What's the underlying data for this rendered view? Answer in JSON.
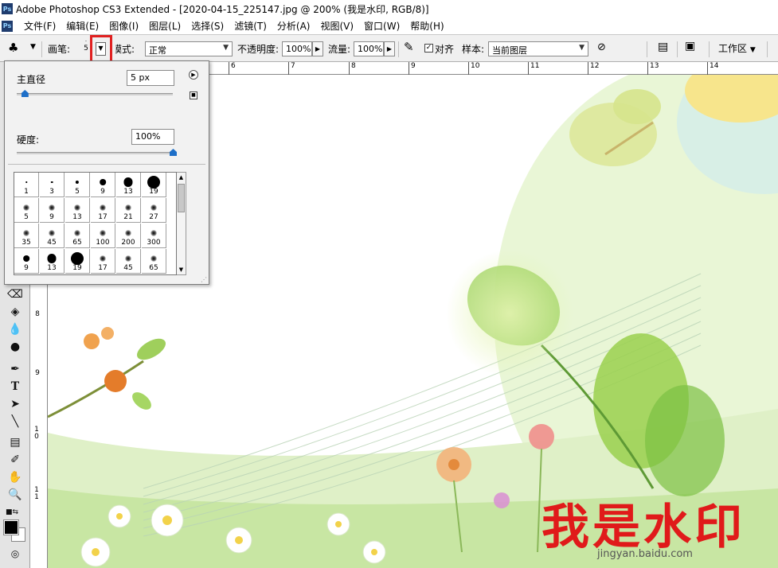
{
  "app": {
    "title": "Adobe Photoshop CS3 Extended - [2020-04-15_225147.jpg @ 200% (我是水印, RGB/8)]",
    "logo": "Ps"
  },
  "menu": [
    "文件(F)",
    "编辑(E)",
    "图像(I)",
    "图层(L)",
    "选择(S)",
    "滤镜(T)",
    "分析(A)",
    "视图(V)",
    "窗口(W)",
    "帮助(H)"
  ],
  "options": {
    "brush_label": "画笔:",
    "brush_size_preview": "5",
    "mode_label": "模式:",
    "mode_value": "正常",
    "opacity_label": "不透明度:",
    "opacity_value": "100%",
    "flow_label": "流量:",
    "flow_value": "100%",
    "aligned_label": "对齐",
    "aligned_checked": true,
    "sample_label": "样本:",
    "sample_value": "当前图层",
    "workspace_label": "工作区"
  },
  "brush_panel": {
    "diameter_label": "主直径",
    "diameter_value": "5 px",
    "diameter_fraction": 0.05,
    "hardness_label": "硬度:",
    "hardness_value": "100%",
    "hardness_fraction": 1.0,
    "presets": [
      {
        "label": "1",
        "size": 1,
        "soft": false
      },
      {
        "label": "3",
        "size": 3,
        "soft": false
      },
      {
        "label": "5",
        "size": 5,
        "soft": false
      },
      {
        "label": "9",
        "size": 9,
        "soft": false
      },
      {
        "label": "13",
        "size": 13,
        "soft": false
      },
      {
        "label": "19",
        "size": 19,
        "soft": false
      },
      {
        "label": "5",
        "size": 5,
        "soft": true
      },
      {
        "label": "9",
        "size": 9,
        "soft": true
      },
      {
        "label": "13",
        "size": 13,
        "soft": true
      },
      {
        "label": "17",
        "size": 17,
        "soft": true
      },
      {
        "label": "21",
        "size": 21,
        "soft": true
      },
      {
        "label": "27",
        "size": 27,
        "soft": true
      },
      {
        "label": "35",
        "size": 35,
        "soft": true
      },
      {
        "label": "45",
        "size": 45,
        "soft": true
      },
      {
        "label": "65",
        "size": 65,
        "soft": true
      },
      {
        "label": "100",
        "size": 100,
        "soft": true
      },
      {
        "label": "200",
        "size": 200,
        "soft": true
      },
      {
        "label": "300",
        "size": 300,
        "soft": true
      },
      {
        "label": "9",
        "size": 9,
        "soft": false
      },
      {
        "label": "13",
        "size": 13,
        "soft": false
      },
      {
        "label": "19",
        "size": 19,
        "soft": false
      },
      {
        "label": "17",
        "size": 17,
        "soft": true
      },
      {
        "label": "45",
        "size": 45,
        "soft": true
      },
      {
        "label": "65",
        "size": 65,
        "soft": true
      }
    ]
  },
  "ruler_h": [
    "6",
    "7",
    "8",
    "9",
    "10",
    "11",
    "12",
    "13",
    "14"
  ],
  "ruler_v": [
    "8",
    "9",
    "1 0",
    "1 1"
  ],
  "canvas": {
    "watermark_text": "我是水印",
    "watermark_url": "jingyan.baidu.com"
  },
  "colors": {
    "highlight": "#e02020",
    "accent": "#1e6fc8",
    "watermark": "#e01a1a"
  }
}
